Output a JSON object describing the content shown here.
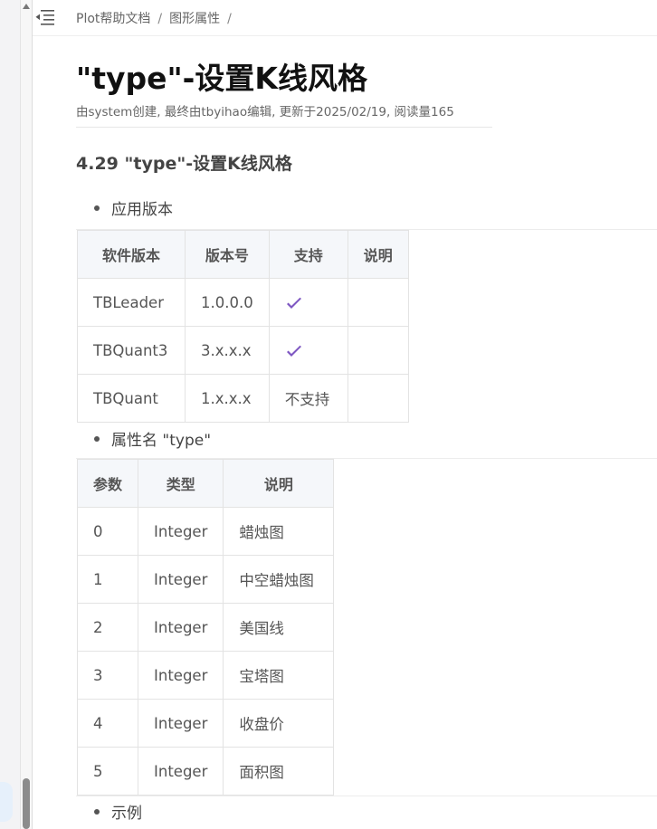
{
  "breadcrumb": {
    "items": [
      "Plot帮助文档",
      "图形属性"
    ],
    "separator": "/"
  },
  "page": {
    "title": "\"type\"-设置K线风格",
    "meta": "由system创建, 最终由tbyihao编辑, 更新于2025/02/19, 阅读量165"
  },
  "section": {
    "heading": "4.29 \"type\"-设置K线风格"
  },
  "version_block": {
    "bullet": "应用版本",
    "headers": [
      "软件版本",
      "版本号",
      "支持",
      "说明"
    ],
    "rows": [
      {
        "software": "TBLeader",
        "version": "1.0.0.0",
        "support": "check-icon",
        "note": ""
      },
      {
        "software": "TBQuant3",
        "version": "3.x.x.x",
        "support": "check-icon",
        "note": ""
      },
      {
        "software": "TBQuant",
        "version": "1.x.x.x",
        "support": "不支持",
        "note": ""
      }
    ]
  },
  "attribute_block": {
    "bullet": "属性名 \"type\"",
    "headers": [
      "参数",
      "类型",
      "说明"
    ],
    "rows": [
      {
        "param": "0",
        "type": "Integer",
        "desc": "蜡烛图"
      },
      {
        "param": "1",
        "type": "Integer",
        "desc": "中空蜡烛图"
      },
      {
        "param": "2",
        "type": "Integer",
        "desc": "美国线"
      },
      {
        "param": "3",
        "type": "Integer",
        "desc": "宝塔图"
      },
      {
        "param": "4",
        "type": "Integer",
        "desc": "收盘价"
      },
      {
        "param": "5",
        "type": "Integer",
        "desc": "面积图"
      }
    ]
  },
  "example_block": {
    "bullet": "示例"
  },
  "colors": {
    "check": "#7e57c2",
    "header_bg": "#f5f7fa",
    "border": "#e3e3e3"
  },
  "icons": {
    "toc_toggle": "outdent-list-icon",
    "support": "check-icon"
  }
}
